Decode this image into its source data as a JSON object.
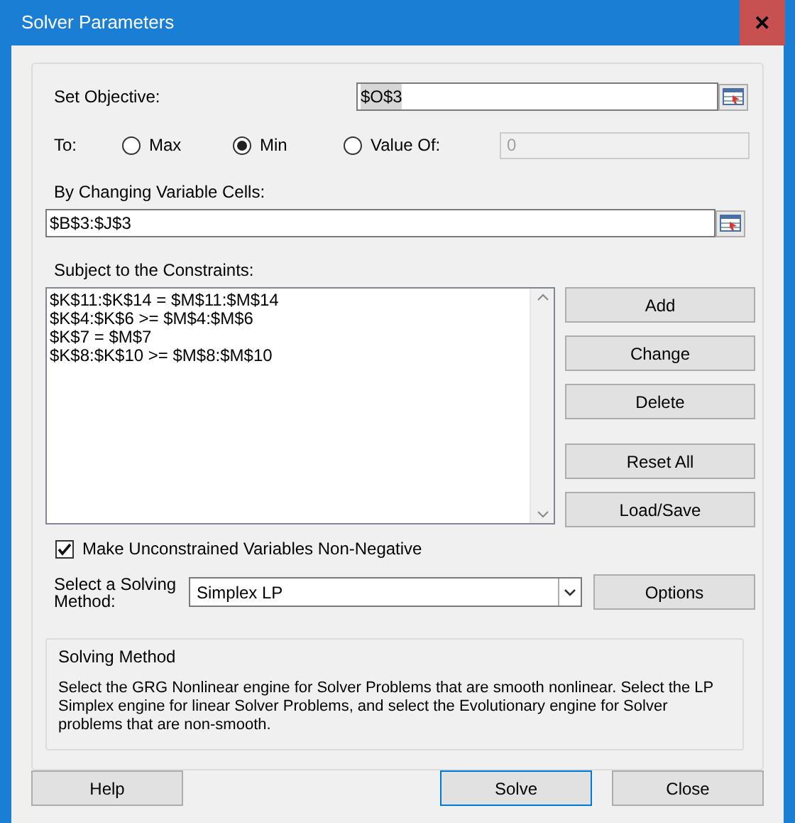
{
  "window": {
    "title": "Solver Parameters",
    "close": "✕"
  },
  "objective": {
    "label": "Set Objective:",
    "value": "$O$3"
  },
  "to": {
    "label": "To:",
    "options": [
      {
        "label": "Max",
        "selected": false
      },
      {
        "label": "Min",
        "selected": true
      },
      {
        "label": "Value Of:",
        "selected": false
      }
    ],
    "value_field": {
      "value": "0",
      "disabled": true
    }
  },
  "variables": {
    "label": "By Changing Variable Cells:",
    "value": "$B$3:$J$3"
  },
  "constraints": {
    "label": "Subject to the Constraints:",
    "items": [
      "$K$11:$K$14 = $M$11:$M$14",
      "$K$4:$K$6 >= $M$4:$M$6",
      "$K$7 = $M$7",
      "$K$8:$K$10 >= $M$8:$M$10"
    ],
    "button_groups": [
      [
        "Add",
        "Change",
        "Delete"
      ],
      [
        "Reset All",
        "Load/Save"
      ]
    ]
  },
  "nonnegative": {
    "label": "Make Unconstrained Variables Non-Negative",
    "checked": true
  },
  "method": {
    "label": "Select a Solving Method:",
    "value": "Simplex LP",
    "options_button": "Options"
  },
  "info": {
    "title": "Solving Method",
    "text": "Select the GRG Nonlinear engine for Solver Problems that are smooth nonlinear. Select the LP Simplex engine for linear Solver Problems, and select the Evolutionary engine for Solver problems that are non-smooth."
  },
  "footer": {
    "help": "Help",
    "solve": "Solve",
    "close": "Close"
  }
}
